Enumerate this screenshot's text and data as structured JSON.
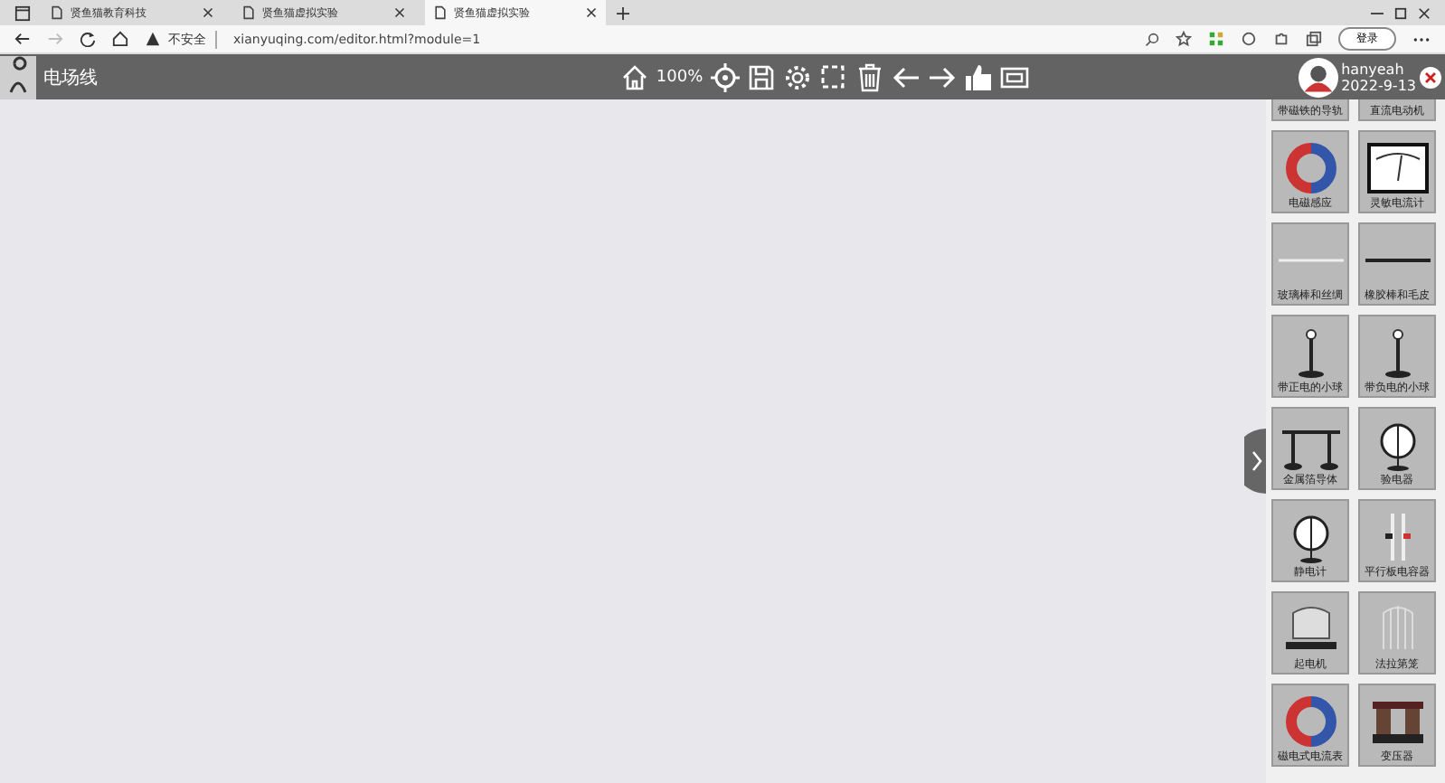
{
  "browser": {
    "tabs": [
      {
        "title": "贤鱼猫教育科技",
        "selected": false
      },
      {
        "title": "贤鱼猫虚拟实验",
        "selected": false
      },
      {
        "title": "贤鱼猫虚拟实验",
        "selected": true
      }
    ],
    "security": "不安全",
    "url": "xianyuqing.com/editor.html?module=1",
    "signin": "登录"
  },
  "toolbar": {
    "title": "电场线",
    "zoom": "100%",
    "user": "hanyeah",
    "date": "2022-9-13"
  },
  "palette": [
    {
      "label": "带磁铁的导轨",
      "kind": "none"
    },
    {
      "label": "直流电动机",
      "kind": "none"
    },
    {
      "label": "电磁感应",
      "kind": "magnet"
    },
    {
      "label": "灵敏电流计",
      "kind": "meter"
    },
    {
      "label": "玻璃棒和丝绸",
      "kind": "rod"
    },
    {
      "label": "橡胶棒和毛皮",
      "kind": "darkrod"
    },
    {
      "label": "带正电的小球",
      "kind": "ball"
    },
    {
      "label": "带负电的小球",
      "kind": "ball"
    },
    {
      "label": "金属箔导体",
      "kind": "stands"
    },
    {
      "label": "验电器",
      "kind": "dial"
    },
    {
      "label": "静电计",
      "kind": "dial"
    },
    {
      "label": "平行板电容器",
      "kind": "plates"
    },
    {
      "label": "起电机",
      "kind": "machine"
    },
    {
      "label": "法拉第笼",
      "kind": "cage"
    },
    {
      "label": "磁电式电流表",
      "kind": "magnet"
    },
    {
      "label": "变压器",
      "kind": "transformer"
    }
  ]
}
